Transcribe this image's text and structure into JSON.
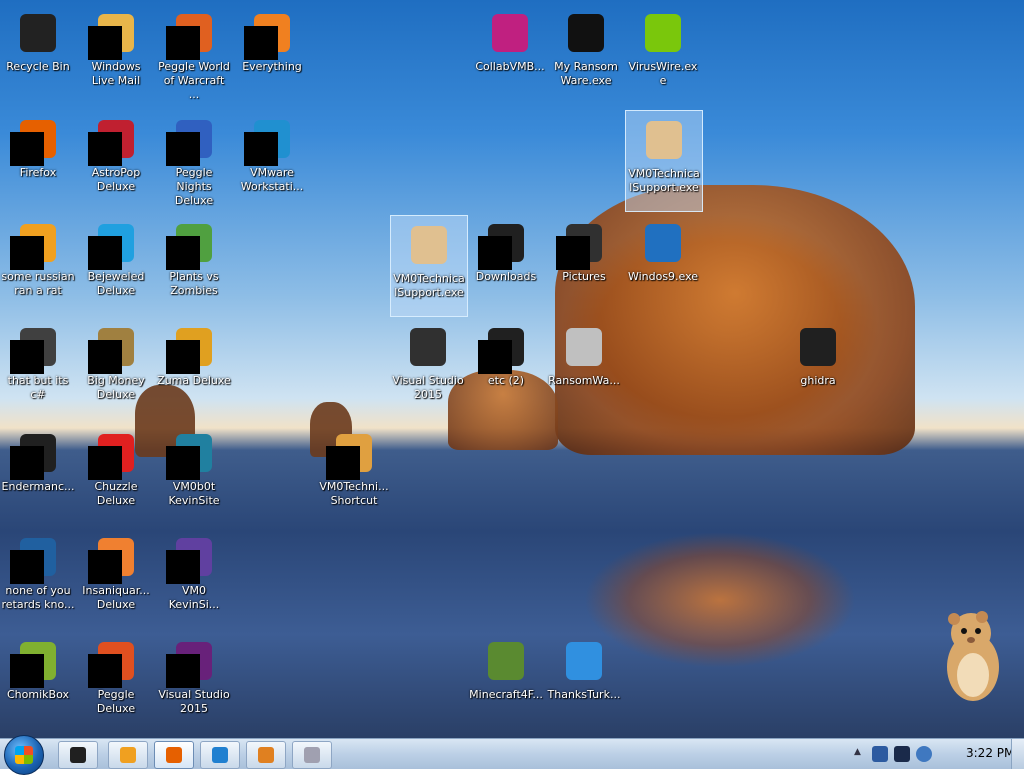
{
  "desktop_icons": [
    {
      "id": "recycle-bin",
      "label": "Recycle Bin",
      "color": "#222222",
      "masked": false,
      "selected": false
    },
    {
      "id": "windows-live-mail",
      "label": "Windows Live Mail",
      "color": "#e8b54a",
      "masked": true,
      "selected": false
    },
    {
      "id": "peggle-world-of-warcraft",
      "label": "Peggle World of Warcraft ...",
      "color": "#e06020",
      "masked": true,
      "selected": false
    },
    {
      "id": "everything",
      "label": "Everything",
      "color": "#f08020",
      "masked": true,
      "selected": false
    },
    {
      "id": "collabvm",
      "label": "CollabVMB...",
      "color": "#c02080",
      "masked": false,
      "selected": false
    },
    {
      "id": "my-ransomware",
      "label": "My Ransom Ware.exe",
      "color": "#111111",
      "masked": false,
      "selected": false
    },
    {
      "id": "viruswire",
      "label": "VirusWire.exe",
      "color": "#7ac70c",
      "masked": false,
      "selected": false
    },
    {
      "id": "firefox",
      "label": "Firefox",
      "color": "#e66000",
      "masked": true,
      "selected": false
    },
    {
      "id": "astropop",
      "label": "AstroPop Deluxe",
      "color": "#c02030",
      "masked": true,
      "selected": false
    },
    {
      "id": "peggle-nights",
      "label": "Peggle Nights Deluxe",
      "color": "#3060c0",
      "masked": true,
      "selected": false
    },
    {
      "id": "vmware",
      "label": "VMware Workstati...",
      "color": "#2090d0",
      "masked": true,
      "selected": false
    },
    {
      "id": "vm0-technical-support",
      "label": "VM0Technica lSupport.exe",
      "color": "#e0c090",
      "masked": false,
      "selected": true
    },
    {
      "id": "some-russian",
      "label": "some russian ran a rat",
      "color": "#f0a020",
      "masked": true,
      "selected": false
    },
    {
      "id": "bejeweled",
      "label": "Bejeweled Deluxe",
      "color": "#20a0e0",
      "masked": true,
      "selected": false
    },
    {
      "id": "plants-vs-zombies",
      "label": "Plants vs Zombies",
      "color": "#50a040",
      "masked": true,
      "selected": false
    },
    {
      "id": "vm0-support-drag",
      "label": "VM0TechnicalSupport.exe",
      "color": "#e0c090",
      "masked": false,
      "selected": true
    },
    {
      "id": "downloads",
      "label": "Downloads",
      "color": "#202020",
      "masked": true,
      "selected": false
    },
    {
      "id": "pictures",
      "label": "Pictures",
      "color": "#303030",
      "masked": true,
      "selected": false
    },
    {
      "id": "windos9",
      "label": "Windos9.exe",
      "color": "#2070c0",
      "masked": false,
      "selected": false
    },
    {
      "id": "that-but-its-csharp",
      "label": "that but its c#",
      "color": "#404040",
      "masked": true,
      "selected": false
    },
    {
      "id": "big-money",
      "label": "Big Money Deluxe",
      "color": "#a08040",
      "masked": true,
      "selected": false
    },
    {
      "id": "zuma",
      "label": "Zuma Deluxe",
      "color": "#e0a020",
      "masked": true,
      "selected": false
    },
    {
      "id": "visual-studio-folder",
      "label": "Visual Studio 2015",
      "color": "#303030",
      "masked": false,
      "selected": false
    },
    {
      "id": "etc-2",
      "label": "etc (2)",
      "color": "#202020",
      "masked": true,
      "selected": false
    },
    {
      "id": "ransomware",
      "label": "RansomWa...",
      "color": "#c0c0c0",
      "masked": false,
      "selected": false
    },
    {
      "id": "ghidra",
      "label": "ghidra",
      "color": "#202020",
      "masked": false,
      "selected": false
    },
    {
      "id": "endermanch",
      "label": "Endermanc...",
      "color": "#202020",
      "masked": true,
      "selected": false
    },
    {
      "id": "chuzzle",
      "label": "Chuzzle Deluxe",
      "color": "#e02020",
      "masked": true,
      "selected": false
    },
    {
      "id": "vm0b0t-kevinsite",
      "label": "VM0b0t KevinSite",
      "color": "#2080a0",
      "masked": true,
      "selected": false
    },
    {
      "id": "vm0techni-shortcut",
      "label": "VM0Techni... Shortcut",
      "color": "#e0a040",
      "masked": true,
      "selected": false
    },
    {
      "id": "none-of-you",
      "label": "none of you retards kno...",
      "color": "#2060a0",
      "masked": true,
      "selected": false
    },
    {
      "id": "insaniquarium",
      "label": "Insaniquar... Deluxe",
      "color": "#f08030",
      "masked": true,
      "selected": false
    },
    {
      "id": "vm0-kevinsi",
      "label": "VM0 KevinSi...",
      "color": "#6040a0",
      "masked": true,
      "selected": false
    },
    {
      "id": "chomikbox",
      "label": "ChomikBox",
      "color": "#80b030",
      "masked": true,
      "selected": false
    },
    {
      "id": "peggle-deluxe",
      "label": "Peggle Deluxe",
      "color": "#e05020",
      "masked": true,
      "selected": false
    },
    {
      "id": "visual-studio-2015",
      "label": "Visual Studio 2015",
      "color": "#68217a",
      "masked": true,
      "selected": false
    },
    {
      "id": "minecraft4f",
      "label": "Minecraft4F...",
      "color": "#5a8a30",
      "masked": false,
      "selected": false
    },
    {
      "id": "thanksturk",
      "label": "ThanksTurk...",
      "color": "#3090e0",
      "masked": false,
      "selected": false
    }
  ],
  "taskbar": {
    "buttons": [
      {
        "id": "cmd",
        "color": "#202020",
        "active": false
      },
      {
        "id": "media-player",
        "color": "#f0a020",
        "active": false
      },
      {
        "id": "firefox",
        "color": "#e66000",
        "active": true
      },
      {
        "id": "ie",
        "color": "#2080d0",
        "active": false
      },
      {
        "id": "vmware",
        "color": "#e08020",
        "active": false
      },
      {
        "id": "app",
        "color": "#a0a0b0",
        "active": false
      }
    ],
    "tray": {
      "arrow": "▲",
      "clock": "3:22 PM"
    }
  },
  "colors": {
    "taskbar_top": "#d9e6f3",
    "taskbar_bottom": "#a9c0da",
    "selection": "#c8e1fa"
  }
}
